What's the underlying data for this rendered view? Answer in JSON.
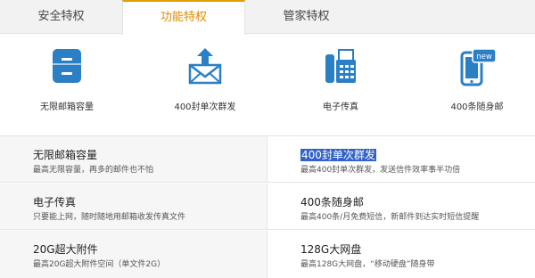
{
  "tabs": [
    {
      "label": "安全特权"
    },
    {
      "label": "功能特权"
    },
    {
      "label": "管家特权"
    }
  ],
  "active_tab": "功能特权",
  "colors": {
    "accent": "#e08a00",
    "icon_blue": "#2b7fc4",
    "selection": "#3264c8"
  },
  "features": [
    {
      "icon": "inbox-icon",
      "label": "无限邮箱容量"
    },
    {
      "icon": "mail-send-icon",
      "label": "400封单次群发"
    },
    {
      "icon": "fax-icon",
      "label": "电子传真"
    },
    {
      "icon": "mobile-new-icon",
      "label": "400条随身邮",
      "badge": "new"
    }
  ],
  "details": [
    {
      "title": "无限邮箱容量",
      "desc": "最高无限容量，再多的邮件也不怕"
    },
    {
      "title": "400封单次群发",
      "desc": "最高400封单次群发，发送信件效率事半功倍",
      "selected": true
    },
    {
      "title": "电子传真",
      "desc": "只要能上网，随时随地用邮箱收发传真文件"
    },
    {
      "title": "400条随身邮",
      "desc": "最高400条/月免费短信，新邮件到达实时短信提醒"
    },
    {
      "title": "20G超大附件",
      "desc": "最高20G超大附件空间（单文件2G）"
    },
    {
      "title": "128G大网盘",
      "desc": "最高128G大网盘，“移动硬盘”随身带"
    }
  ]
}
